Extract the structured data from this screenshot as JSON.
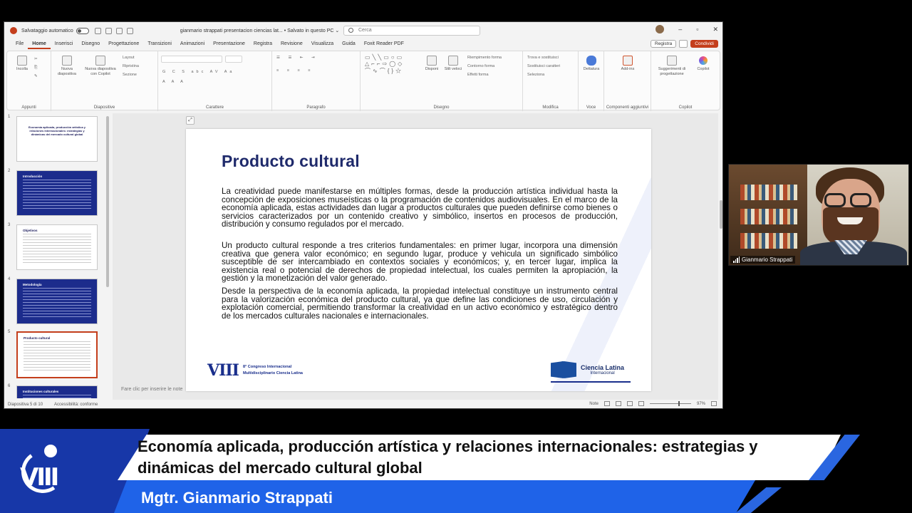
{
  "titlebar": {
    "autosave": "Salvataggio automatico",
    "document_title": "gianmario strappati presentacion ciencias lat... • Salvato in questo PC ⌄",
    "search_placeholder": "Cerca",
    "minimize": "–",
    "restore": "▫",
    "close": "✕"
  },
  "menu": {
    "tabs": [
      "File",
      "Home",
      "Inserisci",
      "Disegno",
      "Progettazione",
      "Transizioni",
      "Animazioni",
      "Presentazione",
      "Registra",
      "Revisione",
      "Visualizza",
      "Guida",
      "Foxit Reader PDF"
    ],
    "registra": "Registra",
    "condividi": "Condividi"
  },
  "ribbon": {
    "incolla": "Incolla",
    "nuova_diapositiva": "Nuova diapositiva",
    "nuova_copilot": "Nuova diapositiva con Copilot",
    "layout": "Layout",
    "ripristina": "Ripristina",
    "sezione": "Sezione",
    "disponi": "Disponi",
    "stili_veloci": "Stili veloci",
    "riempimento": "Riempimento forma",
    "contorno": "Contorno forma",
    "effetti": "Effetti forma",
    "trova": "Trova e sostituisci",
    "sostituisci": "Sostituisci caratteri",
    "seleziona": "Seleziona",
    "dettatura": "Dettatura",
    "addins": "Add-ins",
    "suggerimenti": "Suggerimenti di progettazione",
    "copilot": "Copilot",
    "groups": {
      "appunti": "Appunti",
      "diapositive": "Diapositive",
      "carattere": "Carattere",
      "paragrafo": "Paragrafo",
      "disegno": "Disegno",
      "modifica": "Modifica",
      "voce": "Voce",
      "componenti": "Componenti aggiuntivi",
      "copilot": "Copilot"
    }
  },
  "thumbnails": [
    {
      "num": "1",
      "title": "Economía aplicada, producción artística y relaciones internacionales: estrategias y dinámicas del mercado cultural global"
    },
    {
      "num": "2",
      "title": "Introducción"
    },
    {
      "num": "3",
      "title": "Objetivos"
    },
    {
      "num": "4",
      "title": "Metodología"
    },
    {
      "num": "5",
      "title": "Producto cultural"
    },
    {
      "num": "6",
      "title": "Instituciones culturales"
    }
  ],
  "slide": {
    "title": "Producto cultural",
    "p1": "La creatividad puede manifestarse en múltiples formas, desde la producción artística individual hasta la concepción de exposiciones museísticas o la programación de contenidos audiovisuales. En el marco de la economía aplicada, estas actividades dan lugar a productos culturales que pueden definirse como bienes o servicios caracterizados por un contenido creativo y simbólico, insertos en procesos de producción, distribución y consumo regulados por el mercado.",
    "p2": "Un producto cultural responde a tres criterios fundamentales: en primer lugar, incorpora una dimensión creativa que genera valor económico; en segundo lugar, produce y vehicula un significado simbólico susceptible de ser intercambiado en contextos sociales y económicos; y, en tercer lugar, implica la existencia real o potencial de derechos de propiedad intelectual, los cuales permiten la apropiación, la gestión y la monetización del valor generado.",
    "p3": "Desde la perspectiva de la economía aplicada, la propiedad intelectual constituye un instrumento central para la valorización económica del producto cultural, ya que define las condiciones de uso, circulación y explotación comercial, permitiendo transformar la creatividad en un activo económico y estratégico dentro de los mercados culturales nacionales e internacionales.",
    "congreso_line1": "8° Congreso Internacional",
    "congreso_line2": "Multidisciplinario Ciencia Latina",
    "viii": "VIII",
    "cl_name": "Ciencia Latina",
    "cl_sub": "Internacional"
  },
  "notes_placeholder": "Fare clic per inserire le note",
  "status": {
    "slide_of": "Diapositiva 5 di 10",
    "accessibility": "Accessibilità: conforme",
    "notes": "Note",
    "zoom": "97%"
  },
  "webcam": {
    "name": "Gianmario Strappati"
  },
  "lower_third": {
    "title": "Economía aplicada, producción artística y relaciones internacionales: estrategias y dinámicas del mercado cultural global",
    "presenter": "Mgtr. Gianmario Strappati"
  }
}
